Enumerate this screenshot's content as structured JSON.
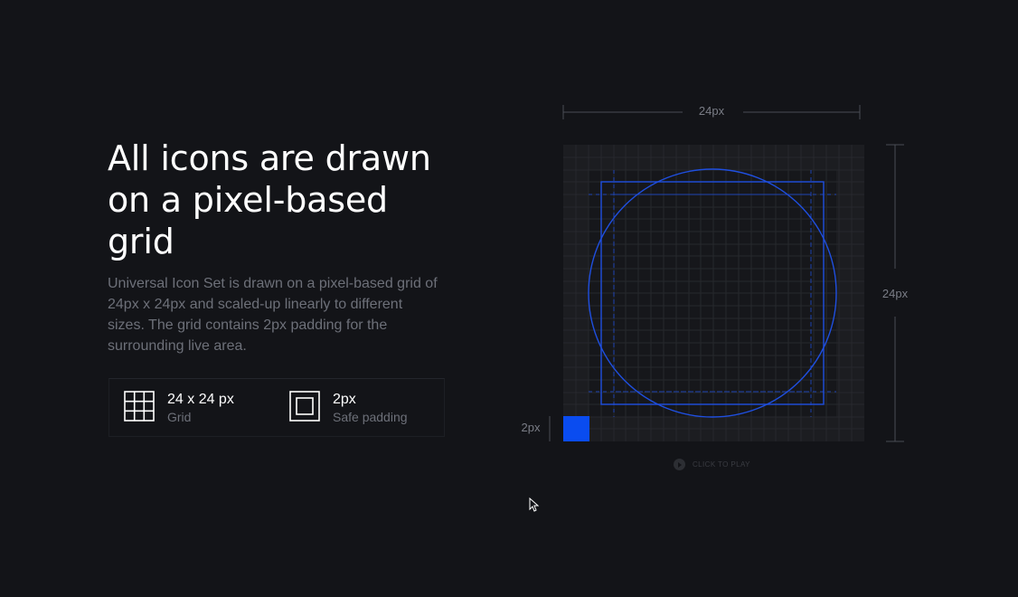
{
  "headline": "All icons are drawn on a pixel-based grid",
  "description": "Universal Icon Set is drawn on a pixel-based grid of 24px x 24px and scaled-up linearly to different sizes. The grid contains 2px padding for the surrounding live area.",
  "specs": [
    {
      "icon": "grid-icon",
      "value": "24 x 24 px",
      "label": "Grid"
    },
    {
      "icon": "safe-padding-icon",
      "value": "2px",
      "label": "Safe padding"
    }
  ],
  "diagram": {
    "width_label": "24px",
    "height_label": "24px",
    "padding_label": "2px",
    "play_label": "CLICK TO PLAY"
  },
  "colors": {
    "background": "#131418",
    "accent": "#1f4fe0",
    "padding_block": "#0a4cf0"
  }
}
